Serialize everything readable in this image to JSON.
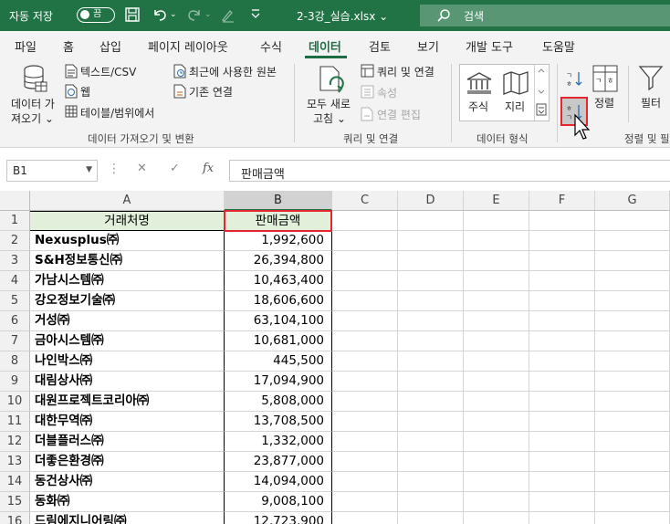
{
  "titlebar": {
    "autosave_label": "자동 저장",
    "toggle_state": "끔",
    "filename": "2-3강_실습.xlsx",
    "filename_chevron": "⌄",
    "search_placeholder": "검색"
  },
  "tabs": [
    "파일",
    "홈",
    "삽입",
    "페이지 레이아웃",
    "수식",
    "데이터",
    "검토",
    "보기",
    "개발 도구",
    "도움말"
  ],
  "active_tab": "데이터",
  "ribbon": {
    "get_data_line1": "데이터 가",
    "get_data_line2": "져오기 ⌄",
    "text_csv": "텍스트/CSV",
    "web": "웹",
    "table_range": "테이블/범위에서",
    "recent_sources": "최근에 사용한 원본",
    "existing_connections": "기존 연결",
    "group_get_transform": "데이터 가져오기 및 변환",
    "refresh_all_line1": "모두 새로",
    "refresh_all_line2": "고침 ⌄",
    "queries_connections": "쿼리 및 연결",
    "properties": "속성",
    "edit_links": "연결 편집",
    "group_queries": "쿼리 및 연결",
    "stocks": "주식",
    "geography": "지리",
    "group_data_types": "데이터 형식",
    "sort": "정렬",
    "filter": "필터",
    "group_sort_filter": "정렬 및 필"
  },
  "formula_bar": {
    "name_box": "B1",
    "fx": "fx",
    "content": "판매금액"
  },
  "columns": [
    "A",
    "B",
    "C",
    "D",
    "E",
    "F",
    "G"
  ],
  "selected_column": "B",
  "rows": [
    {
      "num": "1",
      "a": "거래처명",
      "b": "판매금액"
    },
    {
      "num": "2",
      "a": " Nexusplus㈜",
      "b": "1,992,600"
    },
    {
      "num": "3",
      "a": "S&H정보통신㈜",
      "b": "26,394,800"
    },
    {
      "num": "4",
      "a": "가남시스템㈜",
      "b": "10,463,400"
    },
    {
      "num": "5",
      "a": "강오정보기술㈜",
      "b": "18,606,600"
    },
    {
      "num": "6",
      "a": "거성㈜",
      "b": "63,104,100"
    },
    {
      "num": "7",
      "a": "금아시스템㈜",
      "b": "10,681,000"
    },
    {
      "num": "8",
      "a": "나인박스㈜",
      "b": "445,500"
    },
    {
      "num": "9",
      "a": "대림상사㈜",
      "b": "17,094,900"
    },
    {
      "num": "10",
      "a": "대원프로젝트코리아㈜",
      "b": "5,808,000"
    },
    {
      "num": "11",
      "a": "대한무역㈜",
      "b": "13,708,500"
    },
    {
      "num": "12",
      "a": "더블플러스㈜",
      "b": "1,332,000"
    },
    {
      "num": "13",
      "a": "더좋은환경㈜",
      "b": "23,877,000"
    },
    {
      "num": "14",
      "a": "동건상사㈜",
      "b": "14,094,000"
    },
    {
      "num": "15",
      "a": "동화㈜",
      "b": "9,008,100"
    },
    {
      "num": "16",
      "a": "드림에지니어링㈜",
      "b": "12,723,900"
    }
  ]
}
